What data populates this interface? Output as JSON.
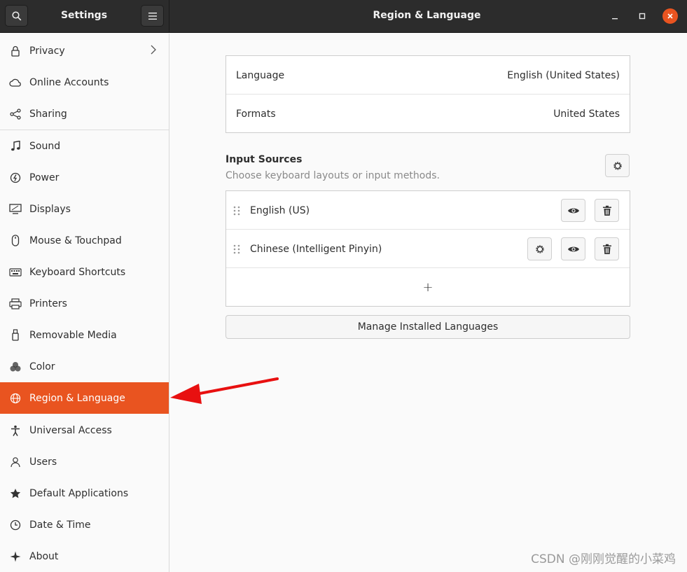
{
  "header": {
    "app_title": "Settings",
    "page_title": "Region & Language"
  },
  "sidebar": {
    "items": [
      {
        "label": "Privacy",
        "icon": "lock-icon"
      },
      {
        "label": "Online Accounts",
        "icon": "cloud-icon"
      },
      {
        "label": "Sharing",
        "icon": "share-icon"
      },
      {
        "label": "Sound",
        "icon": "music-note-icon"
      },
      {
        "label": "Power",
        "icon": "power-icon"
      },
      {
        "label": "Displays",
        "icon": "display-icon"
      },
      {
        "label": "Mouse & Touchpad",
        "icon": "mouse-icon"
      },
      {
        "label": "Keyboard Shortcuts",
        "icon": "keyboard-icon"
      },
      {
        "label": "Printers",
        "icon": "printer-icon"
      },
      {
        "label": "Removable Media",
        "icon": "usb-drive-icon"
      },
      {
        "label": "Color",
        "icon": "color-icon"
      },
      {
        "label": "Region & Language",
        "icon": "globe-icon"
      },
      {
        "label": "Universal Access",
        "icon": "accessibility-icon"
      },
      {
        "label": "Users",
        "icon": "users-icon"
      },
      {
        "label": "Default Applications",
        "icon": "star-icon"
      },
      {
        "label": "Date & Time",
        "icon": "clock-icon"
      },
      {
        "label": "About",
        "icon": "sparkle-icon"
      }
    ],
    "selected": "Region & Language"
  },
  "language_panel": {
    "language_label": "Language",
    "language_value": "English (United States)",
    "formats_label": "Formats",
    "formats_value": "United States"
  },
  "input_sources": {
    "title": "Input Sources",
    "subtitle": "Choose keyboard layouts or input methods.",
    "sources": [
      {
        "name": "English (US)"
      },
      {
        "name": "Chinese (Intelligent Pinyin)"
      }
    ],
    "add_label": "+",
    "manage_label": "Manage Installed Languages"
  },
  "watermark": "CSDN @刚刚觉醒的小菜鸡",
  "colors": {
    "accent": "#e95420",
    "arrow": "#e81010",
    "header": "#2c2c2c"
  }
}
